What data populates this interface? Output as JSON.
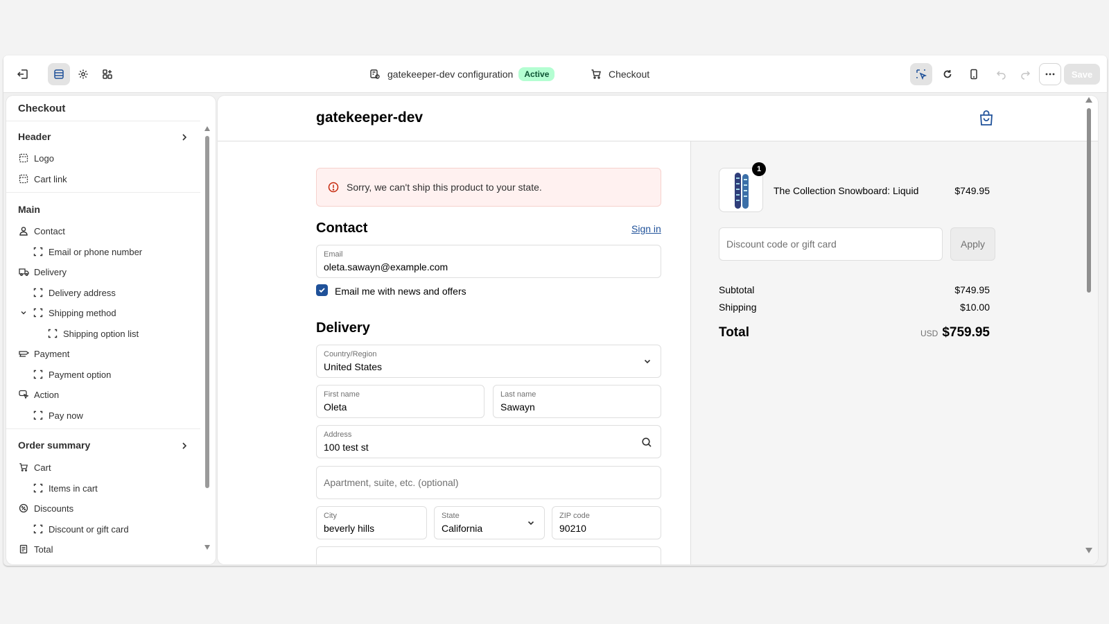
{
  "topbar": {
    "config_name": "gatekeeper-dev configuration",
    "status_badge": "Active",
    "page_name": "Checkout",
    "save_label": "Save"
  },
  "sidebar": {
    "title": "Checkout",
    "sections": {
      "header": "Header",
      "main": "Main",
      "order_summary": "Order summary"
    },
    "items": {
      "logo": "Logo",
      "cart_link": "Cart link",
      "contact": "Contact",
      "email_or_phone": "Email or phone number",
      "delivery": "Delivery",
      "delivery_address": "Delivery address",
      "shipping_method": "Shipping method",
      "shipping_option_list": "Shipping option list",
      "payment": "Payment",
      "payment_option": "Payment option",
      "action": "Action",
      "pay_now": "Pay now",
      "cart": "Cart",
      "items_in_cart": "Items in cart",
      "discounts": "Discounts",
      "discount_or_gift_card": "Discount or gift card",
      "total": "Total"
    }
  },
  "preview": {
    "store_name": "gatekeeper-dev",
    "alert_text": "Sorry, we can't ship this product to your state.",
    "contact": {
      "heading": "Contact",
      "sign_in": "Sign in",
      "email_label": "Email",
      "email_value": "oleta.sawayn@example.com",
      "newsletter_label": "Email me with news and offers"
    },
    "delivery": {
      "heading": "Delivery",
      "country_label": "Country/Region",
      "country_value": "United States",
      "first_name_label": "First name",
      "first_name_value": "Oleta",
      "last_name_label": "Last name",
      "last_name_value": "Sawayn",
      "address_label": "Address",
      "address_value": "100 test st",
      "apartment_placeholder": "Apartment, suite, etc. (optional)",
      "city_label": "City",
      "city_value": "beverly hills",
      "state_label": "State",
      "state_value": "California",
      "zip_label": "ZIP code",
      "zip_value": "90210"
    },
    "summary": {
      "product_name": "The Collection Snowboard: Liquid",
      "product_price": "$749.95",
      "quantity": "1",
      "discount_placeholder": "Discount code or gift card",
      "apply_label": "Apply",
      "subtotal_label": "Subtotal",
      "subtotal_value": "$749.95",
      "shipping_label": "Shipping",
      "shipping_value": "$10.00",
      "total_label": "Total",
      "currency": "USD",
      "total_value": "$759.95"
    }
  },
  "colors": {
    "accent_blue": "#1f5199",
    "active_badge_bg": "#b4fed2",
    "alert_bg": "#fff1f0"
  }
}
